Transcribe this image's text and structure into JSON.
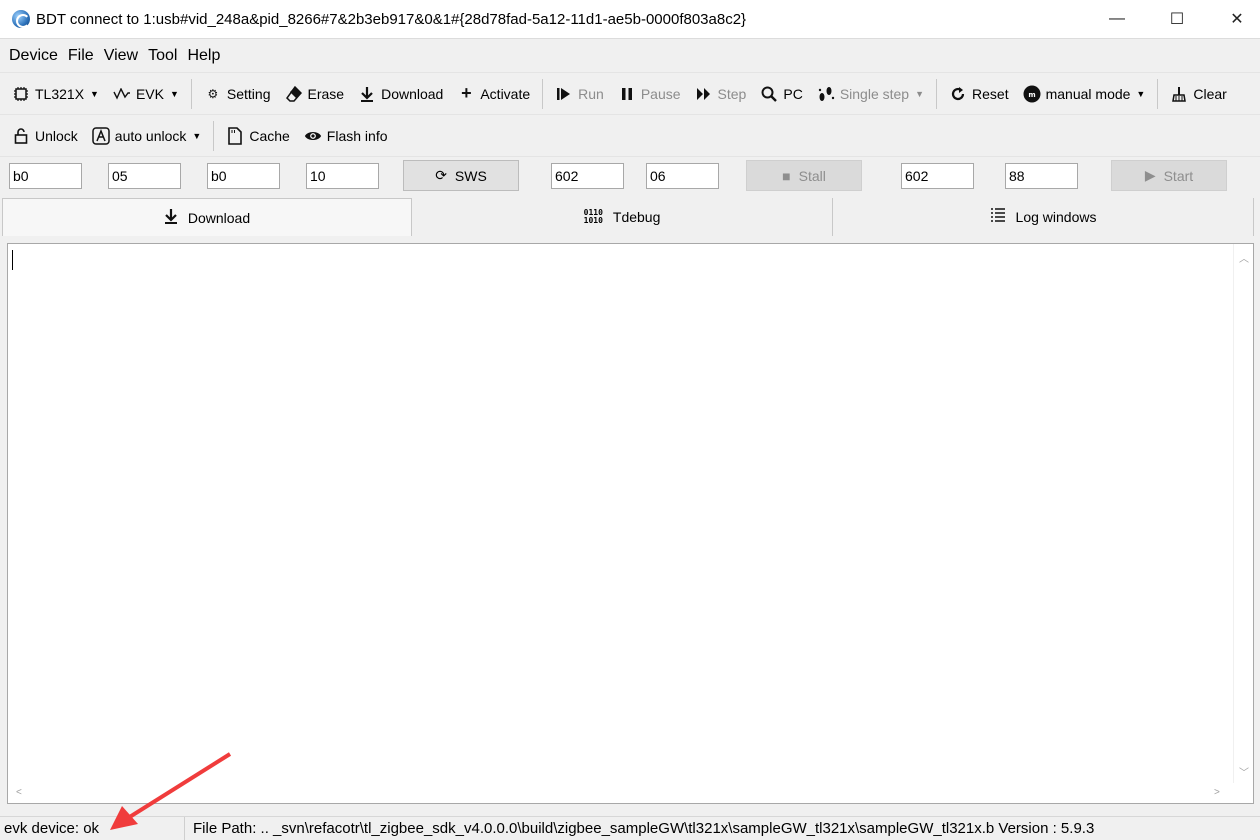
{
  "window": {
    "title": "BDT connect to 1:usb#vid_248a&pid_8266#7&2b3eb917&0&1#{28d78fad-5a12-11d1-ae5b-0000f803a8c2}",
    "controls": [
      "—",
      "☐",
      "✕"
    ]
  },
  "menu": [
    "Device",
    "File",
    "View",
    "Tool",
    "Help"
  ],
  "toolbar1": {
    "chip": "TL321X",
    "board": "EVK",
    "setting": "Setting",
    "erase": "Erase",
    "download": "Download",
    "activate": "Activate",
    "run": "Run",
    "pause": "Pause",
    "step": "Step",
    "pc": "PC",
    "single_step": "Single step",
    "reset": "Reset",
    "manual_mode": "manual mode",
    "clear": "Clear"
  },
  "toolbar2": {
    "unlock": "Unlock",
    "auto_unlock": "auto unlock",
    "cache": "Cache",
    "flash_info": "Flash info"
  },
  "inputs": {
    "f1": "b0",
    "f2": "05",
    "f3": "b0",
    "f4": "10",
    "sws_button": "SWS",
    "f5": "602",
    "f6": "06",
    "stall_button": "Stall",
    "f7": "602",
    "f8": "88",
    "start_button": "Start"
  },
  "tabs": [
    "Download",
    "Tdebug",
    "Log windows"
  ],
  "status": {
    "device": "evk device: ok",
    "file_path": "File Path:   ..  _svn\\refacotr\\tl_zigbee_sdk_v4.0.0.0\\build\\zigbee_sampleGW\\tl321x\\sampleGW_tl321x\\sampleGW_tl321x.b Version : 5.9.3"
  },
  "colors": {
    "annotation_arrow": "#f03c3c"
  }
}
